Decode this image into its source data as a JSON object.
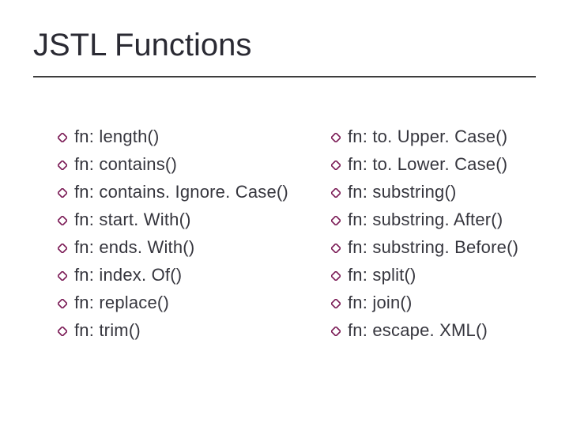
{
  "title": "JSTL Functions",
  "bullet_color": "#7a1a55",
  "columns": {
    "left": [
      "fn: length()",
      "fn: contains()",
      "fn: contains. Ignore. Case()",
      "fn: start. With()",
      "fn: ends. With()",
      "fn: index. Of()",
      "fn: replace()",
      "fn: trim()"
    ],
    "right": [
      "fn: to. Upper. Case()",
      "fn: to. Lower. Case()",
      "fn: substring()",
      "fn: substring. After()",
      "fn: substring. Before()",
      "fn: split()",
      "fn: join()",
      "fn: escape. XML()"
    ]
  }
}
